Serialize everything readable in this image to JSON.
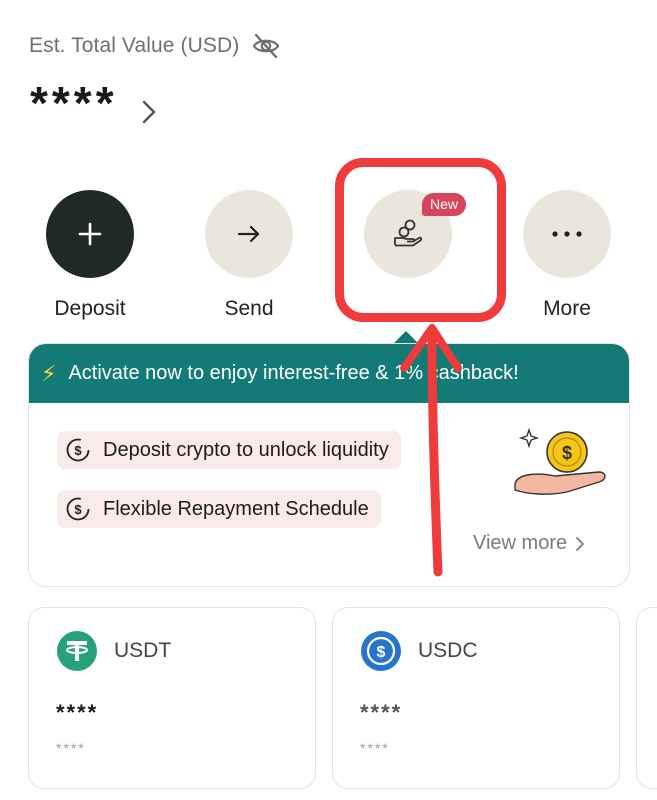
{
  "header": {
    "label": "Est. Total Value (USD)",
    "eye_icon": "eye-off-icon"
  },
  "balance": {
    "masked_value": "****",
    "chevron_icon": "chevron-right-icon"
  },
  "actions": [
    {
      "label": "Deposit",
      "icon": "plus-icon"
    },
    {
      "label": "Send",
      "icon": "arrow-right-icon"
    },
    {
      "label": "",
      "icon": "coins-hand-icon",
      "badge": "New"
    },
    {
      "label": "More",
      "icon": "more-dots-icon"
    }
  ],
  "promo": {
    "headline": "Activate now to enjoy interest-free & 1% cashback!",
    "features": [
      "Deposit crypto to unlock liquidity",
      "Flexible Repayment Schedule"
    ],
    "view_more": "View more"
  },
  "coins": [
    {
      "symbol": "USDT",
      "amount": "****",
      "fiat": "****",
      "color": "#26a17b"
    },
    {
      "symbol": "USDC",
      "amount": "****",
      "fiat": "****",
      "color": "#2775ca"
    }
  ],
  "colors": {
    "accent": "#137a76",
    "badge": "#d6455d",
    "annotation": "#ee3b3b"
  }
}
